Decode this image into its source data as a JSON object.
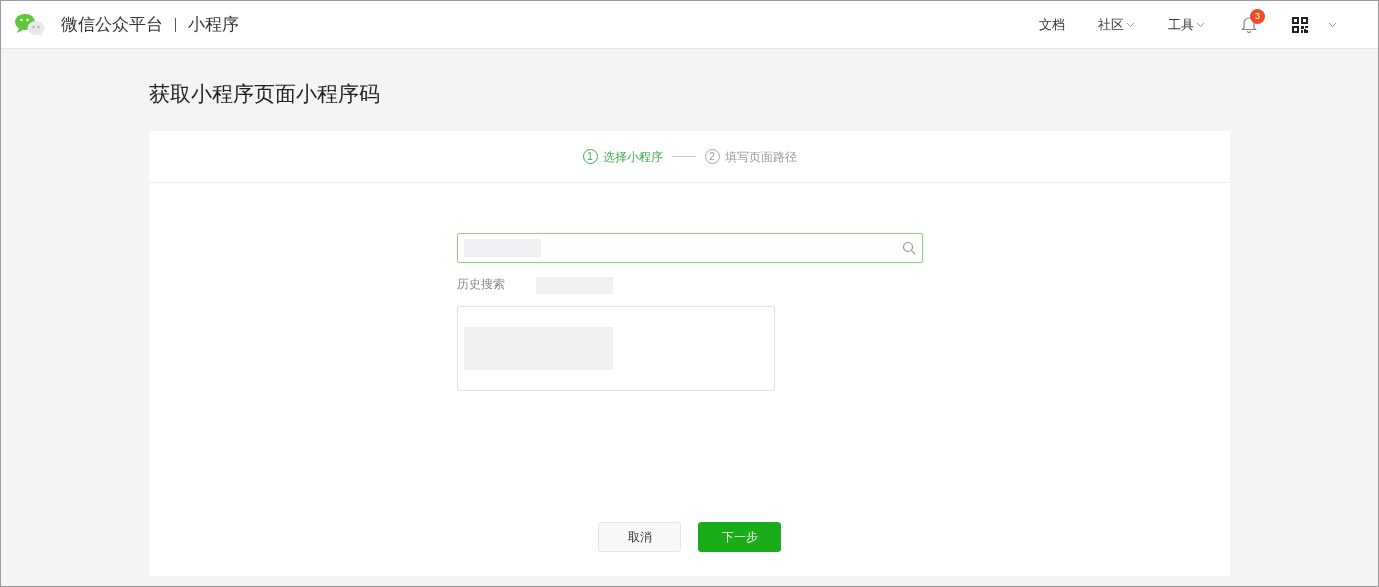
{
  "header": {
    "brand": "微信公众平台",
    "product": "小程序",
    "nav": [
      {
        "kind": "link",
        "label": "文档"
      },
      {
        "kind": "dropdown",
        "label": "社区"
      },
      {
        "kind": "dropdown",
        "label": "工具"
      }
    ],
    "notifications": {
      "count": "3"
    }
  },
  "page_title": "获取小程序页面小程序码",
  "steps": [
    {
      "number": "1",
      "label": "选择小程序",
      "selected": true
    },
    {
      "number": "2",
      "label": "填写页面路径",
      "selected": false
    }
  ],
  "history_label": "历史搜索",
  "buttons": [
    {
      "kind": "secondary",
      "label": "取消"
    },
    {
      "kind": "primary",
      "label": "下一步"
    }
  ]
}
